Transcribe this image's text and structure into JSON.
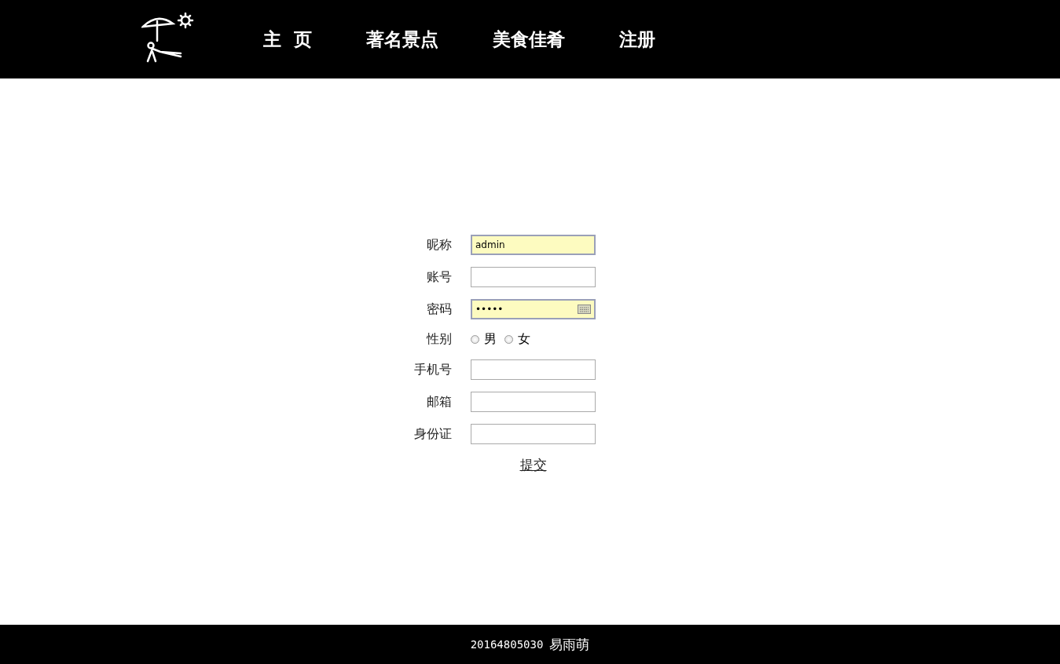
{
  "nav": [
    {
      "label": "主  页"
    },
    {
      "label": "著名景点"
    },
    {
      "label": "美食佳肴"
    },
    {
      "label": "注册"
    }
  ],
  "form": {
    "fields": [
      {
        "kind": "text",
        "label": "昵称",
        "value": "admin",
        "autofilled": true
      },
      {
        "kind": "text",
        "label": "账号",
        "autofilled": false
      },
      {
        "kind": "password",
        "label": "密码",
        "value": "•••••",
        "autofilled": true
      },
      {
        "kind": "radio",
        "label": "性别",
        "options": [
          {
            "label": "男",
            "selected": false
          },
          {
            "label": "女",
            "selected": false
          }
        ]
      },
      {
        "kind": "text",
        "label": "手机号",
        "autofilled": false
      },
      {
        "kind": "text",
        "label": "邮箱",
        "autofilled": false
      },
      {
        "kind": "text",
        "label": "身份证",
        "autofilled": false
      }
    ],
    "submit": "提交"
  },
  "footer": {
    "id": "20164805030",
    "name": "易雨萌"
  }
}
